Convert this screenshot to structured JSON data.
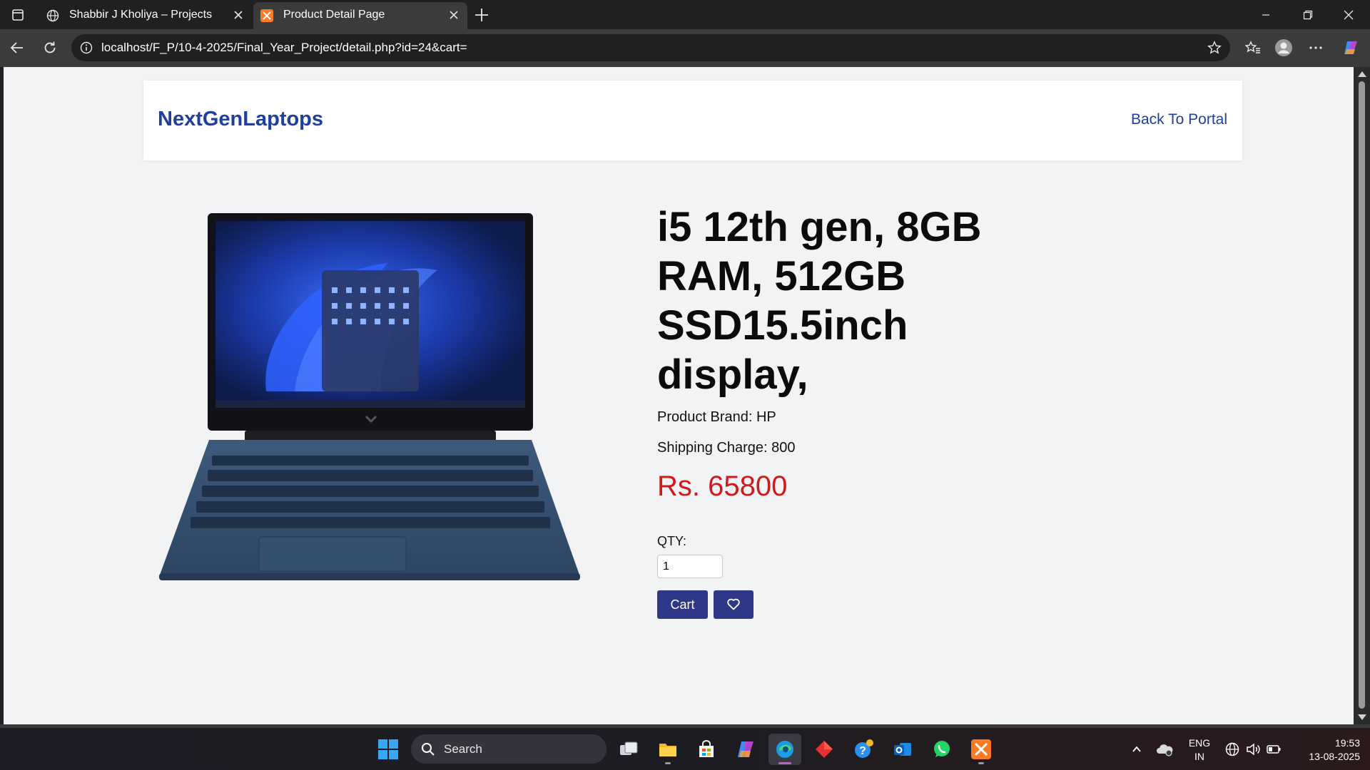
{
  "browser": {
    "tabs": [
      {
        "title": "Shabbir J Kholiya – Projects",
        "icon": "globe-icon",
        "active": false
      },
      {
        "title": "Product Detail Page",
        "icon": "xampp-icon",
        "active": true
      }
    ],
    "url": "localhost/F_P/10-4-2025/Final_Year_Project/detail.php?id=24&cart="
  },
  "site": {
    "brand": "NextGenLaptops",
    "back_link": "Back To Portal",
    "brand_color": "#1f3fa0"
  },
  "product": {
    "image": "laptop-image",
    "title": "i5 12th gen, 8GB RAM, 512GB SSD15.5inch display,",
    "brand_text": "Product Brand: HP",
    "shipping_text": "Shipping Charge: 800",
    "price_text": "Rs. 65800",
    "price_color": "#d11a1a",
    "qty_label": "QTY:",
    "qty_value": "1",
    "cart_label": "Cart",
    "wishlist_icon": "heart-icon",
    "button_color": "#2e3788"
  },
  "taskbar": {
    "search_label": "Search",
    "language": "ENG",
    "region": "IN",
    "time": "19:53",
    "date": "13-08-2025"
  }
}
